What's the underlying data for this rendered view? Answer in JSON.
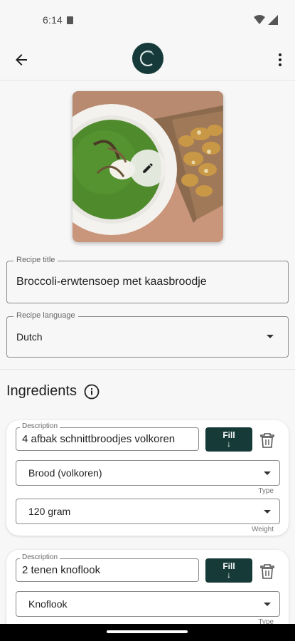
{
  "status": {
    "time": "6:14"
  },
  "appbar": {
    "back_icon": "arrow-left-icon",
    "menu_icon": "more-vert-icon"
  },
  "recipe": {
    "edit_icon": "pencil-icon",
    "title_label": "Recipe title",
    "title_value": "Broccoli-erwtensoep met kaasbroodje",
    "language_label": "Recipe language",
    "language_value": "Dutch"
  },
  "ingredients": {
    "heading": "Ingredients",
    "info_icon": "info-icon",
    "items": [
      {
        "description_label": "Description",
        "description": "4 afbak schnittbroodjes volkoren",
        "fill_label": "Fill",
        "type": "Brood (volkoren)",
        "type_label": "Type",
        "weight": "120 gram",
        "weight_label": "Weight"
      },
      {
        "description_label": "Description",
        "description": "2 tenen knoflook",
        "fill_label": "Fill",
        "type": "Knoflook",
        "type_label": "Type"
      }
    ]
  },
  "colors": {
    "accent": "#153a37",
    "background": "#f7f7f7"
  }
}
